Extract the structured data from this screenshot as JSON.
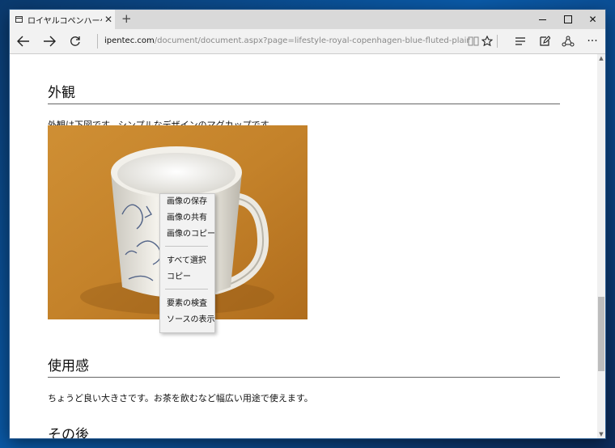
{
  "browser": {
    "tab_title": "ロイヤルコペンハーゲン　ブル",
    "url_host": "ipentec.com",
    "url_path": "/document/document.aspx?page=lifestyle-royal-copenhagen-blue-fluted-plain-mag-s&culture=ja-jp",
    "icons": [
      "tab-page-icon",
      "tab-close-icon",
      "new-tab-icon",
      "back-icon",
      "forward-icon",
      "refresh-icon",
      "reading-view-icon",
      "favorite-star-icon",
      "hub-icon",
      "web-note-icon",
      "share-icon",
      "more-icon",
      "minimize-icon",
      "maximize-icon",
      "close-icon"
    ]
  },
  "page": {
    "heading1": "外観",
    "para1": "外観は下図です。シンプルなデザインのマグカップです。",
    "heading2": "使用感",
    "para2": "ちょうど良い大きさです。お茶を飲むなど幅広い用途で使えます。",
    "heading3": "その後"
  },
  "context_menu": {
    "save_image": "画像の保存",
    "share_image": "画像の共有",
    "copy_image": "画像のコピー",
    "select_all": "すべて選択",
    "copy": "コピー",
    "inspect": "要素の検査",
    "view_source": "ソースの表示"
  },
  "colors": {
    "accent_frame": "#2b5d92",
    "menu_bg": "#f2f2f2",
    "photo_bg": "#c98a2a"
  }
}
